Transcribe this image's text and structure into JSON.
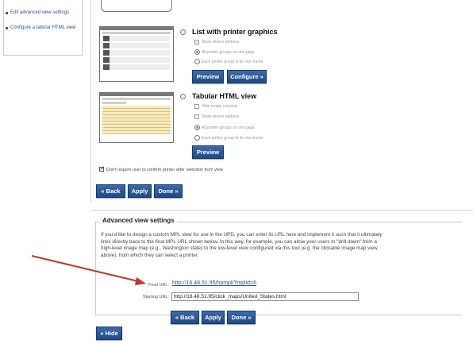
{
  "sidebar": {
    "links": [
      "Edit advanced view settings",
      "Configure a tabular HTML view"
    ]
  },
  "options": {
    "graphics": {
      "title": "List with printer graphics",
      "items": [
        "Show device address",
        "All printer groups on one page",
        "Each printer group in its own frame"
      ],
      "preview": "Preview",
      "configure": "Configure »"
    },
    "tabular": {
      "title": "Tabular HTML view",
      "items": [
        "Hide empty columns",
        "Show device address",
        "All printer groups on one page",
        "Each printer group in its own frame"
      ],
      "preview": "Preview"
    }
  },
  "confirm_label": "Don't require user to confirm printer after selection from view",
  "nav": {
    "back": "« Back",
    "apply": "Apply",
    "done": "Done »"
  },
  "advanced": {
    "legend": "Advanced view settings",
    "description": "If you'd like to design a custom MPL view for use in the UPD, you can enter its URL here and implement it such that it ultimately links directly back to the final MPL URL shown below. In this way, for example, you can allow your users to \"drill down\" from a high-level image map (e.g., Washington state) to the low-level view configured via this tool (e.g. the clickable image map view above), from which they can select a printer.",
    "final_url_label": "Final URL:",
    "final_url": "http://16.48.51.95/hpmpl/?mplid=6",
    "starting_url_label": "Starting URL:",
    "starting_url": "http://16.48.51.95/click_maps/United_States.html",
    "back": "« Back",
    "apply": "Apply",
    "done": "Done »"
  },
  "hide": "« Hide",
  "colors": {
    "button": "#1f4a86",
    "link": "#2a4f9e",
    "arrow": "#c0392b"
  }
}
